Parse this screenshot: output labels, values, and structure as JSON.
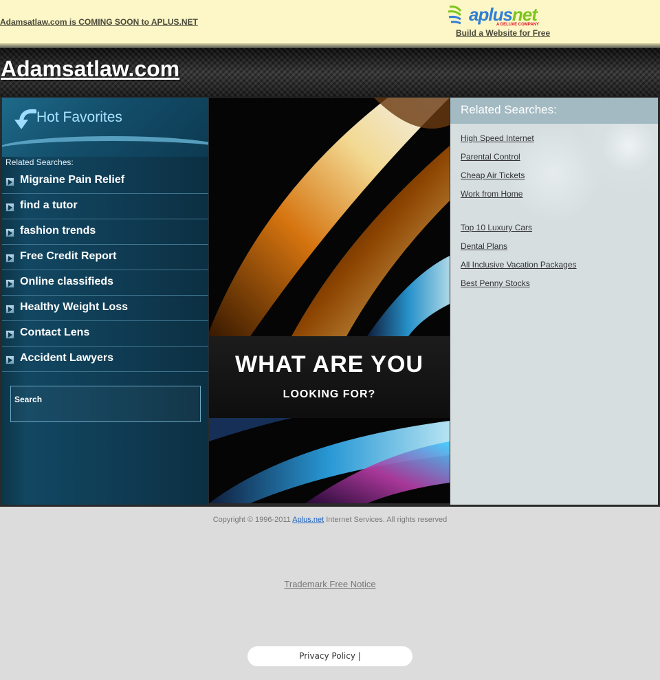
{
  "top_banner": {
    "coming_soon_text": "Adamsatlaw.com is COMING SOON to APLUS.NET",
    "logo_brand": "aplus",
    "logo_brand_suffix": "net",
    "logo_tagline": "A DELUXE COMPANY",
    "build_link": "Build a Website for Free"
  },
  "header": {
    "site_title": "Adamsatlaw.com"
  },
  "sidebar": {
    "title": "Hot Favorites",
    "related_label": "Related Searches:",
    "items": [
      {
        "label": "Migraine Pain Relief"
      },
      {
        "label": "find a tutor"
      },
      {
        "label": "fashion trends"
      },
      {
        "label": "Free Credit Report"
      },
      {
        "label": "Online classifieds"
      },
      {
        "label": "Healthy Weight Loss"
      },
      {
        "label": "Contact Lens"
      },
      {
        "label": "Accident Lawyers"
      }
    ],
    "search_label": "Search"
  },
  "hero": {
    "line1": "WHAT ARE YOU",
    "line2": "LOOKING FOR?"
  },
  "right_panel": {
    "title": "Related Searches:",
    "links_group1": [
      "High Speed Internet",
      "Parental Control",
      "Cheap Air Tickets",
      "Work from Home"
    ],
    "links_group2": [
      "Top 10 Luxury Cars",
      "Dental Plans",
      "All Inclusive Vacation Packages",
      "Best Penny Stocks"
    ]
  },
  "footer": {
    "copyright_prefix": "Copyright © 1996-2011 ",
    "copyright_link": "Aplus.net",
    "copyright_suffix": " Internet Services. All rights reserved",
    "trademark": "Trademark Free Notice",
    "privacy": "Privacy Policy |"
  },
  "colors": {
    "banner_bg": "#fdf6c7",
    "sidebar_bg": "#124762",
    "right_panel_bg": "#d6dee0",
    "right_header_bg": "#a3bac3",
    "link_blue": "#1a5fc0"
  }
}
